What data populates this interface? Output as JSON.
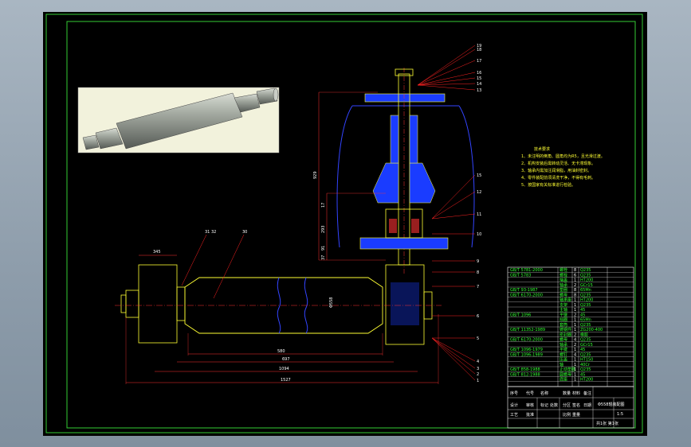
{
  "colors": {
    "frame": "#33cc33",
    "drawing_line": "#ffff33",
    "hidden_line": "#3333ff",
    "section_hatch": "#3366ff",
    "leader": "#ff2222",
    "center_line": "#ff3333",
    "dim_text": "#ffffff"
  },
  "balloons_right": [
    "1",
    "2",
    "3",
    "4",
    "5",
    "6",
    "7",
    "8",
    "9",
    "10",
    "11",
    "12",
    "15"
  ],
  "balloons_top": [
    "13",
    "14",
    "15",
    "16",
    "17",
    "18",
    "19"
  ],
  "balloons_left": [
    "31",
    "32",
    "30"
  ],
  "dims_horizontal": [
    "580",
    "697",
    "1094",
    "1527"
  ],
  "dims_vertical": [
    "929",
    "17",
    "293",
    "91",
    "37"
  ],
  "dim_roll_dia": "Φ558",
  "dim_flange": "345",
  "tech_notes": [
    "技术要求",
    "1、未注明的倒角、圆角均为R5，且光滑过渡。",
    "2、机构安装后需转动灵活、无卡滞现象。",
    "3、轴承内需加注润滑脂，用油封密封。",
    "4、零件装配前须清洗干净，不得有毛刺。",
    "5、按国家有关标准进行检验。"
  ],
  "bom_rows": [
    {
      "code": "GB/T 5781-2000",
      "name": "螺栓",
      "qty": "8",
      "mat": "Q235"
    },
    {
      "code": "GB/T 5783",
      "name": "螺栓",
      "qty": "6",
      "mat": "Q235"
    },
    {
      "code": "",
      "name": "端盖",
      "qty": "1",
      "mat": "HT200"
    },
    {
      "code": "",
      "name": "轴承",
      "qty": "2",
      "mat": "GCr15"
    },
    {
      "code": "GB/T 93-1987",
      "name": "垫圈",
      "qty": "8",
      "mat": "65Mn"
    },
    {
      "code": "GB/T 6170-2000",
      "name": "螺母",
      "qty": "8",
      "mat": "Q235"
    },
    {
      "code": "",
      "name": "轴承座",
      "qty": "1",
      "mat": "HT200"
    },
    {
      "code": "",
      "name": "支架",
      "qty": "1",
      "mat": "Q235"
    },
    {
      "code": "",
      "name": "主轴",
      "qty": "1",
      "mat": "45"
    },
    {
      "code": "GB/T 1096",
      "name": "平键",
      "qty": "2",
      "mat": "45"
    },
    {
      "code": "",
      "name": "挡圈",
      "qty": "1",
      "mat": "65Mn"
    },
    {
      "code": "",
      "name": "套筒",
      "qty": "1",
      "mat": "Q235"
    },
    {
      "code": "GB/T 11352-1989",
      "name": "铸钢件",
      "qty": "1",
      "mat": "ZG200-400"
    },
    {
      "code": "",
      "name": "密封圈",
      "qty": "2",
      "mat": "橡胶"
    },
    {
      "code": "GB/T 6170-2000",
      "name": "螺母",
      "qty": "4",
      "mat": "Q235"
    },
    {
      "code": "",
      "name": "轴承",
      "qty": "2",
      "mat": "GCr15"
    },
    {
      "code": "GB/T 1096-1979",
      "name": "平键",
      "qty": "1",
      "mat": "45"
    },
    {
      "code": "GB/T 1096-1989",
      "name": "螺钉",
      "qty": "4",
      "mat": "Q235"
    },
    {
      "code": "",
      "name": "压盖",
      "qty": "1",
      "mat": "HT150"
    },
    {
      "code": "",
      "name": "轴",
      "qty": "1",
      "mat": "40Cr"
    },
    {
      "code": "GB/T 858-1988",
      "name": "止动垫圈",
      "qty": "1",
      "mat": "Q235"
    },
    {
      "code": "GB/T 812-1988",
      "name": "圆螺母",
      "qty": "1",
      "mat": "45"
    },
    {
      "code": "",
      "name": "底座",
      "qty": "1",
      "mat": "HT200"
    }
  ],
  "title_block": {
    "drawing_title": "Φ558辊装配图",
    "scale": "1:5",
    "sheet": "共1张 第1张",
    "cells": [
      "序号",
      "代号",
      "名称",
      "数量",
      "材料",
      "备注",
      "设计",
      "审核",
      "工艺",
      "批准",
      "标记",
      "处数",
      "分区",
      "签名",
      "日期",
      "比例",
      "重量"
    ]
  }
}
